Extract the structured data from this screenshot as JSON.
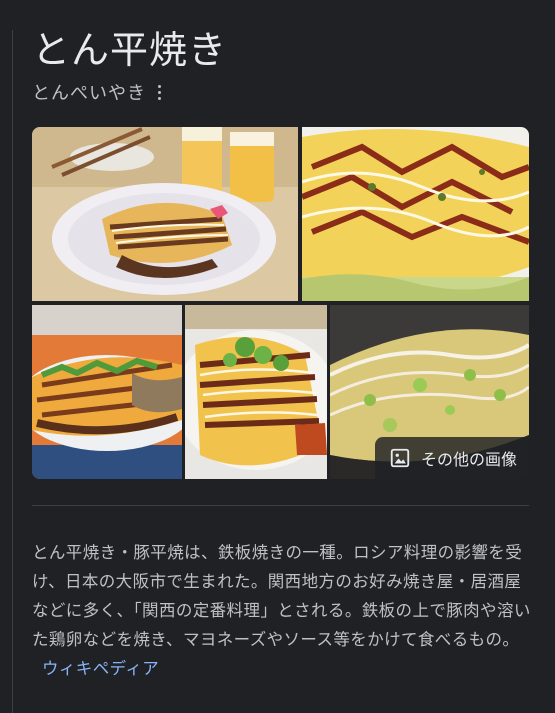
{
  "entity": {
    "title": "とん平焼き",
    "reading": "とんぺいやき"
  },
  "gallery": {
    "more_images_label": "その他の画像",
    "more_images_icon": "image-icon",
    "tiles": [
      {
        "subject": "tonpeiyaki on plate with beer"
      },
      {
        "subject": "tonpeiyaki closeup with sauce"
      },
      {
        "subject": "tonpeiyaki with green onion"
      },
      {
        "subject": "tonpeiyaki topped with scallions"
      },
      {
        "subject": "tonpeiyaki with mayonnaise"
      }
    ]
  },
  "description": {
    "text": "とん平焼き・豚平焼は、鉄板焼きの一種。ロシア料理の影響を受け、日本の大阪市で生まれた。関西地方のお好み焼き屋・居酒屋などに多く、「関西の定番料理」とされる。鉄板の上で豚肉や溶いた鶏卵などを焼き、マヨネーズやソース等をかけて食べるもの。",
    "source_link": "ウィキペディア"
  },
  "colors": {
    "background": "#202124",
    "text_primary": "#e8eaed",
    "text_secondary": "#bdc1c6",
    "link": "#8ab4f8"
  }
}
